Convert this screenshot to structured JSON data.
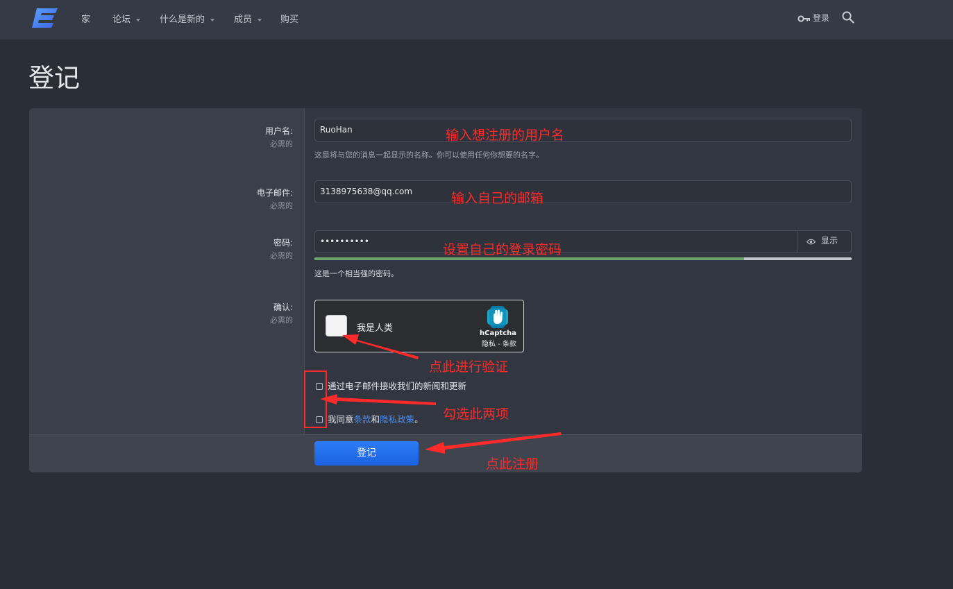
{
  "nav": {
    "items": [
      {
        "label": "家",
        "has_dropdown": false
      },
      {
        "label": "论坛",
        "has_dropdown": true
      },
      {
        "label": "什么是新的",
        "has_dropdown": true
      },
      {
        "label": "成员",
        "has_dropdown": true
      },
      {
        "label": "购买",
        "has_dropdown": false
      }
    ],
    "login_label": "登录",
    "login_icon": "key-icon",
    "search_icon": "search-icon"
  },
  "page": {
    "title": "登记"
  },
  "form": {
    "username": {
      "label": "用户名:",
      "required": "必需的",
      "value": "RuoHan",
      "explain": "这是将与您的消息一起显示的名称。你可以使用任何你想要的名字。"
    },
    "email": {
      "label": "电子邮件:",
      "required": "必需的",
      "value": "3138975638@qq.com"
    },
    "password": {
      "label": "密码:",
      "required": "必需的",
      "value": "••••••••••",
      "show_label": "显示",
      "strength_fraction": 0.8,
      "strength_text": "这是一个相当强的密码。"
    },
    "confirm": {
      "label": "确认:",
      "required": "必需的",
      "captcha_text": "我是人类",
      "captcha_brand": "hCaptcha",
      "captcha_links": "隐私 - 条款"
    },
    "newsletter_label": "通过电子邮件接收我们的新闻和更新",
    "agree": {
      "prefix": "我同意",
      "terms": "条款",
      "and": "和",
      "privacy": "隐私政策",
      "suffix": "。"
    },
    "submit_label": "登记"
  },
  "annotations": {
    "username": "输入想注册的用户名",
    "email": "输入自己的邮箱",
    "password": "设置自己的登录密码",
    "captcha": "点此进行验证",
    "checkboxes": "勾选此两项",
    "submit": "点此注册",
    "color": "#ff2a2a"
  }
}
